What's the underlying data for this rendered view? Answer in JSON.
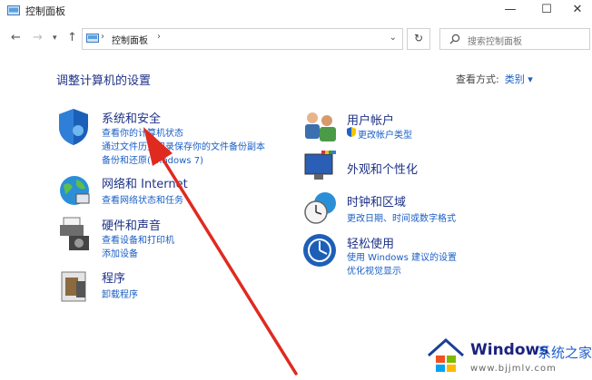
{
  "window": {
    "title": "控制面板",
    "minimize": "—",
    "maximize": "☐",
    "close": "✕"
  },
  "address": {
    "breadcrumb": "控制面板",
    "separator": "›",
    "search_placeholder": "搜索控制面板"
  },
  "page": {
    "heading": "调整计算机的设置",
    "view_by_label": "查看方式:",
    "view_by_value": "类别 ▾"
  },
  "categories": [
    {
      "title": "系统和安全",
      "links": [
        "查看你的计算机状态",
        "通过文件历史记录保存你的文件备份副本",
        "备份和还原(Windows 7)"
      ]
    },
    {
      "title": "网络和 Internet",
      "links": [
        "查看网络状态和任务"
      ]
    },
    {
      "title": "硬件和声音",
      "links": [
        "查看设备和打印机",
        "添加设备"
      ]
    },
    {
      "title": "程序",
      "links": [
        "卸载程序"
      ]
    },
    {
      "title": "用户帐户",
      "links": [
        "更改帐户类型"
      ]
    },
    {
      "title": "外观和个性化",
      "links": []
    },
    {
      "title": "时钟和区域",
      "links": [
        "更改日期、时间或数字格式"
      ]
    },
    {
      "title": "轻松使用",
      "links": [
        "使用 Windows 建议的设置",
        "优化视觉显示"
      ]
    }
  ],
  "watermark": {
    "brand": "Windows",
    "site_name": "系统之家",
    "url": "www.bjjmlv.com"
  },
  "colors": {
    "heading": "#1e3287",
    "link": "#1a5fc4",
    "arrow": "#e02a20"
  }
}
